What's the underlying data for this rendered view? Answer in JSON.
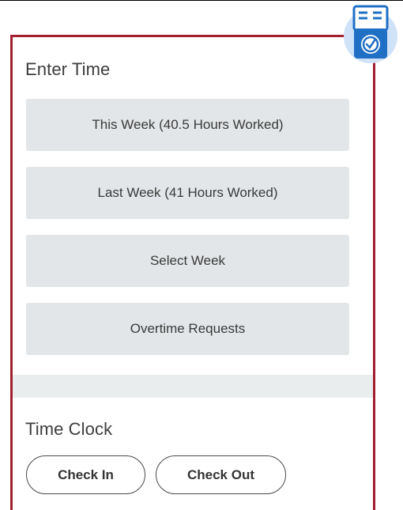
{
  "enter_time": {
    "title": "Enter Time",
    "options": [
      {
        "label": "This Week (40.5 Hours Worked)"
      },
      {
        "label": "Last Week (41 Hours Worked)"
      },
      {
        "label": "Select Week"
      },
      {
        "label": "Overtime Requests"
      }
    ]
  },
  "time_clock": {
    "title": "Time Clock",
    "check_in_label": "Check In",
    "check_out_label": "Check Out"
  },
  "icons": {
    "app_icon": "time-clock-app-icon"
  },
  "colors": {
    "border": "#a31f2f",
    "tile_bg": "#e3e6e8",
    "icon_blue": "#1f6fc5",
    "icon_bg": "#cfe2f7"
  }
}
